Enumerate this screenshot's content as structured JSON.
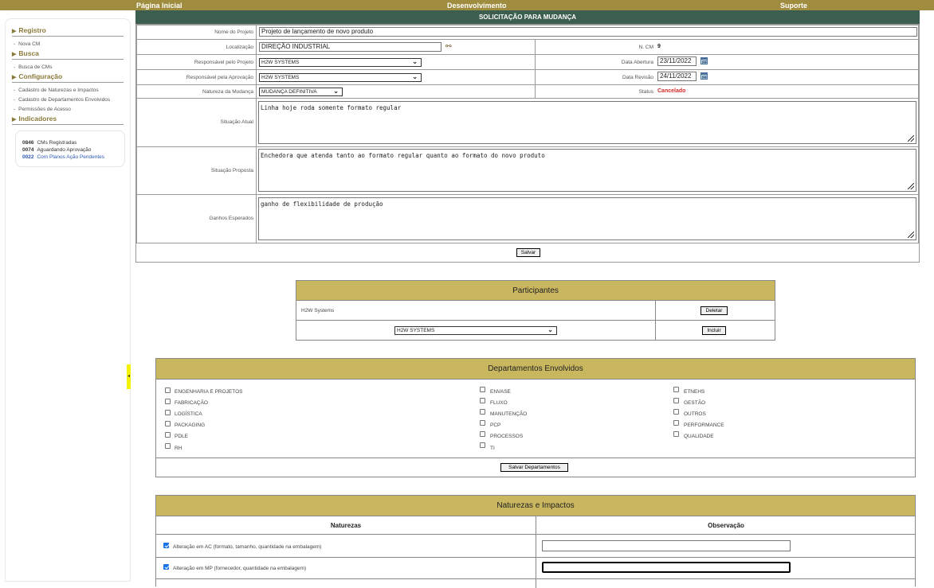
{
  "topnav": {
    "home": "Página Inicial",
    "dev": "Desenvolvimento",
    "support": "Suporte"
  },
  "sidebar": {
    "sections": [
      {
        "title": "Registro",
        "items": [
          "Nova CM"
        ]
      },
      {
        "title": "Busca",
        "items": [
          "Busca de CMs"
        ]
      },
      {
        "title": "Configuração",
        "items": [
          "Cadastro de Naturezas e Impactos",
          "Cadastro de Departamentos Envolvidos",
          "Permissões de Acesso"
        ]
      },
      {
        "title": "Indicadores",
        "items": []
      }
    ],
    "stats": [
      {
        "count": "0846",
        "label": "CMs Registradas",
        "color": "#333333"
      },
      {
        "count": "0074",
        "label": "Aguardando Aprovação",
        "color": "#333333"
      },
      {
        "count": "0022",
        "label": "Com Planos Ação Pendentes",
        "color": "#2a58b8"
      }
    ]
  },
  "form": {
    "title": "SOLICITAÇÃO PARA MUDANÇA",
    "project_name_label": "Nome do Projeto",
    "project_name": "Projeto de lançamento de novo produto",
    "location_label": "Localização",
    "location": "DIREÇÃO INDUSTRIAL",
    "ncm_label": "N. CM",
    "ncm": "9",
    "resp_project_label": "Responsável pelo Projeto",
    "resp_project": "H2W SYSTEMS",
    "open_date_label": "Data Abertura",
    "open_date": "23/11/2022",
    "resp_approval_label": "Responsável pela Aprovação",
    "resp_approval": "H2W SYSTEMS",
    "review_date_label": "Data Revisão",
    "review_date": "24/11/2022",
    "nature_label": "Natureza da Mudança",
    "nature": "MUDANÇA DEFINITIVA",
    "status_label": "Status",
    "status": "Cancelado",
    "status_color": "#d42a2a",
    "current_label": "Situação Atual",
    "current": "Linha hoje roda somente formato regular",
    "proposed_label": "Situação Proposta",
    "proposed": "Enchedora que atenda tanto ao formato regular quanto ao formato do novo produto",
    "gains_label": "Ganhos Esperados",
    "gains": "ganho de flexibilidade de produção",
    "save": "Salvar"
  },
  "participants": {
    "title": "Participantes",
    "existing": "H2W Systems",
    "delete": "Deletar",
    "select": "H2W SYSTEMS",
    "add": "Incluir"
  },
  "departments": {
    "title": "Departamentos Envolvidos",
    "col1": [
      "ENGENHARIA E PROJETOS",
      "FABRICAÇÃO",
      "LOGÍSTICA",
      "PACKAGING",
      "PDLE",
      "RH"
    ],
    "col2": [
      "ENVASE",
      "FLUXO",
      "MANUTENÇÃO",
      "PCP",
      "PROCESSOS",
      "TI"
    ],
    "col3": [
      "ETNEHS",
      "GESTÃO",
      "OUTROS",
      "PERFORMANCE",
      "QUALIDADE"
    ],
    "save": "Salvar Departamentos"
  },
  "natures": {
    "title": "Naturezas e Impactos",
    "col_natures": "Naturezas",
    "col_obs": "Observação",
    "rows": [
      {
        "label": "Alteração em AC (formato, tamanho, quantidade na embalagem)",
        "checked": true,
        "obs": ""
      },
      {
        "label": "Alteração em MP (fornecedor, quantidade na embalagem)",
        "checked": true,
        "obs": ""
      }
    ]
  },
  "colors": {
    "gold": "#a08c3f",
    "panel_head": "#c9b760",
    "form_title": "#3b5e4f",
    "nav_heading": "#8a7a3a"
  }
}
